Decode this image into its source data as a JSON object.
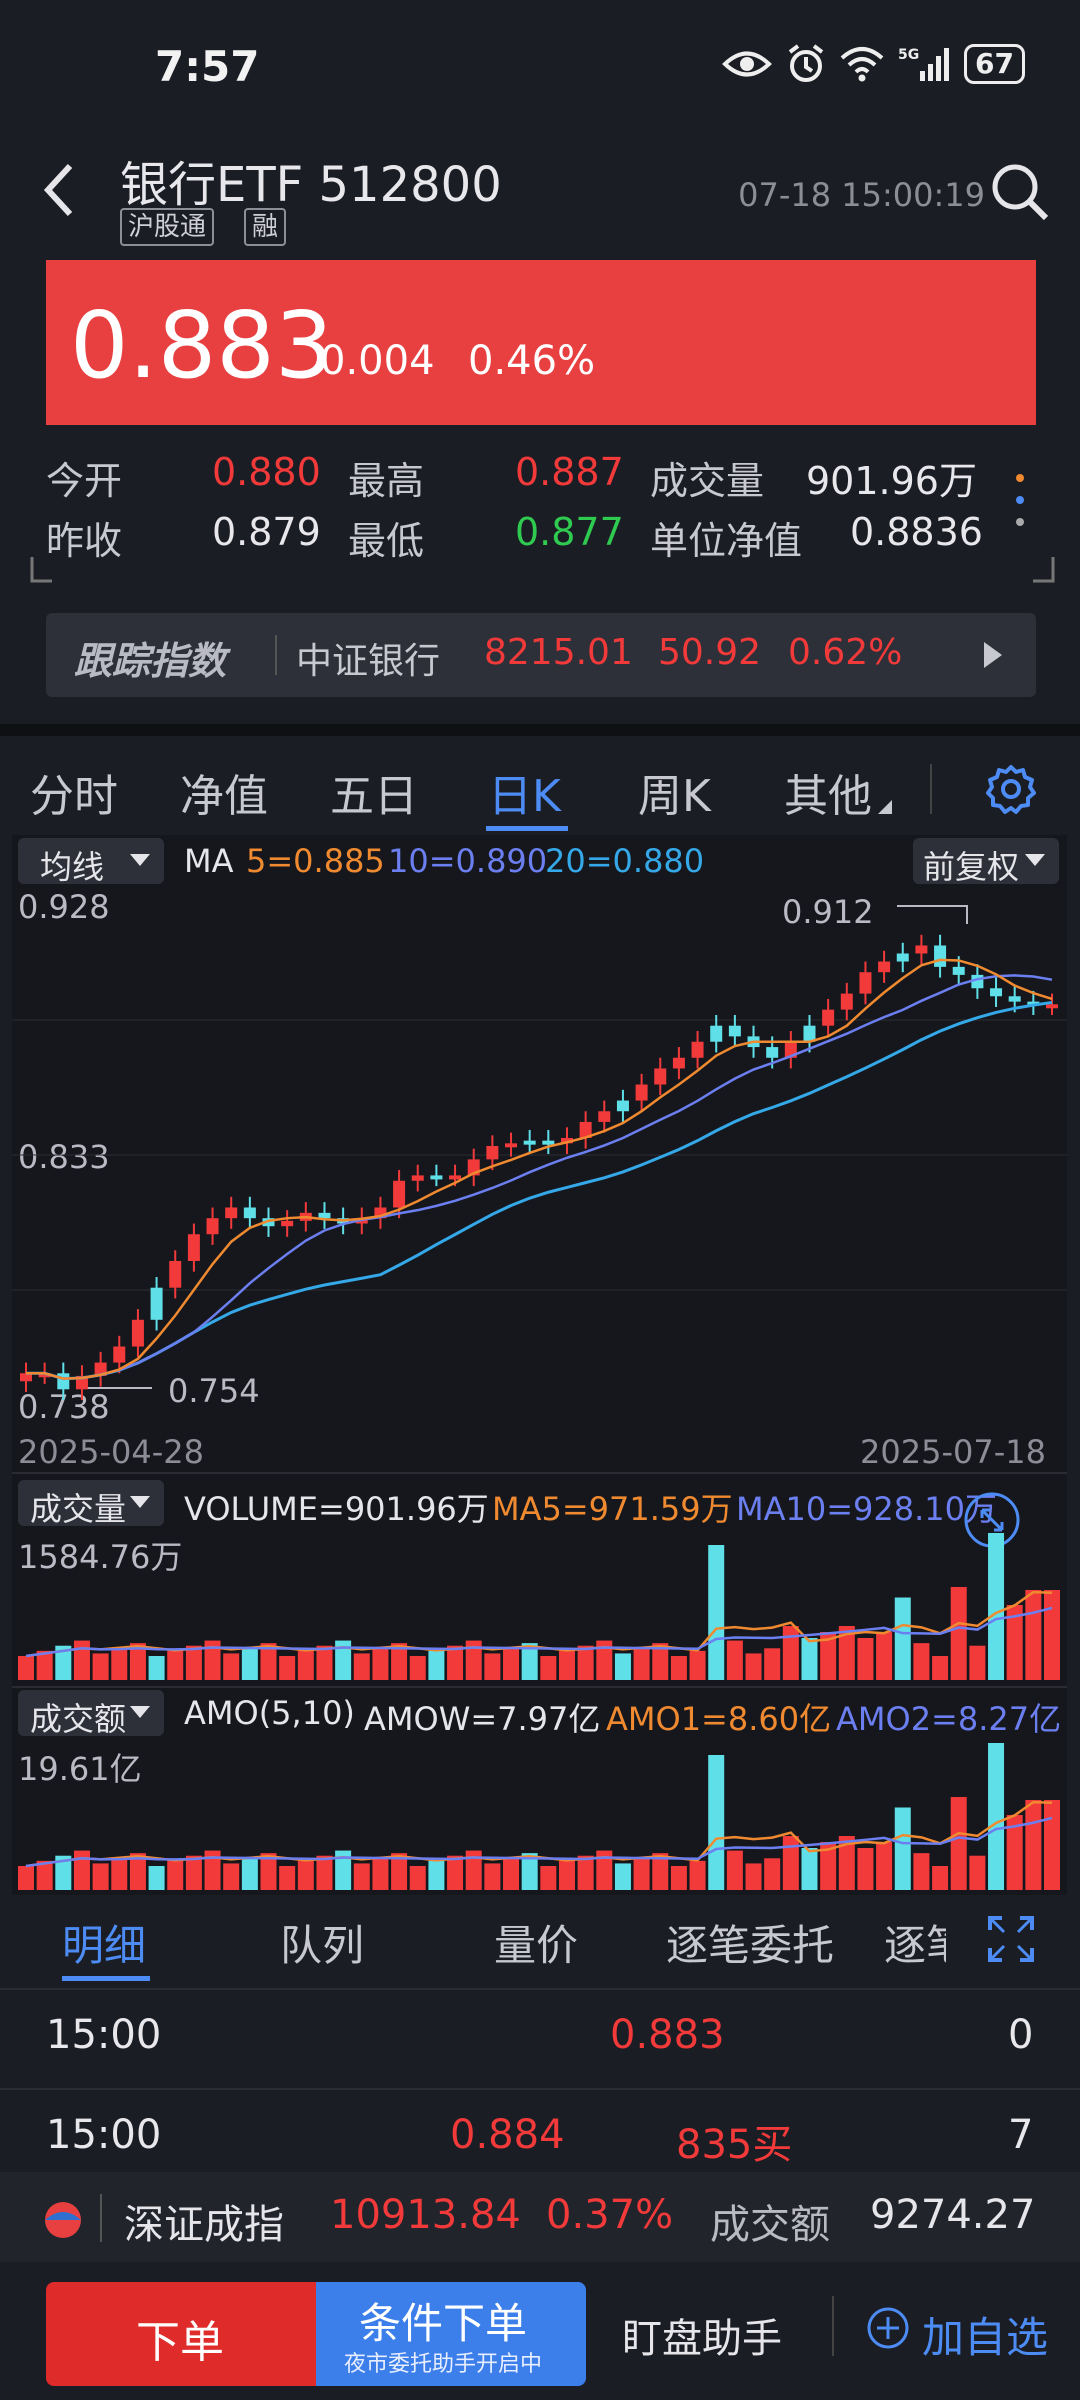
{
  "status_bar": {
    "time": "7:57",
    "battery": "67",
    "network": "5G"
  },
  "header": {
    "title": "银行ETF 512800",
    "tags": [
      "沪股通",
      "融"
    ],
    "datetime": "07-18 15:00:19"
  },
  "price": {
    "last": "0.883",
    "change": "0.004",
    "change_pct": "0.46%"
  },
  "stats": {
    "open_label": "今开",
    "open": "0.880",
    "high_label": "最高",
    "high": "0.887",
    "volume_label": "成交量",
    "volume": "901.96万",
    "prev_close_label": "昨收",
    "prev_close": "0.879",
    "low_label": "最低",
    "low": "0.877",
    "nav_label": "单位净值",
    "nav": "0.8836"
  },
  "tracking": {
    "label": "跟踪指数",
    "name": "中证银行",
    "value": "8215.01",
    "change": "50.92",
    "pct": "0.62%"
  },
  "chart_tabs": [
    {
      "label": "分时"
    },
    {
      "label": "净值"
    },
    {
      "label": "五日"
    },
    {
      "label": "日K",
      "active": true
    },
    {
      "label": "周K"
    },
    {
      "label": "其他"
    }
  ],
  "kline": {
    "indicator_dropdown": "均线",
    "ma_label": "MA",
    "ma5": "5=0.885",
    "ma10": "10=0.890",
    "ma20": "20=0.880",
    "adjust_dropdown": "前复权",
    "y_top": "0.928",
    "y_mid": "0.833",
    "y_bottom": "0.738",
    "high_mark": "0.912",
    "low_mark": "0.754",
    "date_start": "2025-04-28",
    "date_end": "2025-07-18"
  },
  "volume": {
    "dropdown": "成交量",
    "volume_text": "VOLUME=901.96万",
    "ma5_text": "MA5=971.59万",
    "ma10_text": "MA10=928.10万",
    "max_label": "1584.76万"
  },
  "amount": {
    "dropdown": "成交额",
    "amo_label": "AMO(5,10)",
    "amow": "AMOW=7.97亿",
    "amo1": "AMO1=8.60亿",
    "amo2": "AMO2=8.27亿",
    "max_label": "19.61亿"
  },
  "detail_tabs": [
    {
      "label": "明细",
      "active": true
    },
    {
      "label": "队列"
    },
    {
      "label": "量价"
    },
    {
      "label": "逐笔委托"
    },
    {
      "label": "逐笔"
    }
  ],
  "detail_rows": [
    {
      "time": "15:00",
      "price": "",
      "price2": "0.883",
      "qty": "0"
    },
    {
      "time": "15:00",
      "price": "0.884",
      "price2": "835买",
      "qty": "7"
    }
  ],
  "ticker": {
    "name": "深证成指",
    "value": "10913.84",
    "pct": "0.37%",
    "amount_label": "成交额",
    "amount": "9274.27"
  },
  "actions": {
    "order": "下单",
    "cond_order": "条件下单",
    "cond_sub": "夜市委托助手开启中",
    "monitor": "盯盘助手",
    "add_watch": "加自选"
  },
  "colors": {
    "up": "#f23a3a",
    "down_fill": "#5fe0e8",
    "accent": "#4d8cf5",
    "panel": "#e84040",
    "ma5": "#f08a30",
    "ma10": "#6c7ff0",
    "ma20": "#35a8e8"
  }
}
